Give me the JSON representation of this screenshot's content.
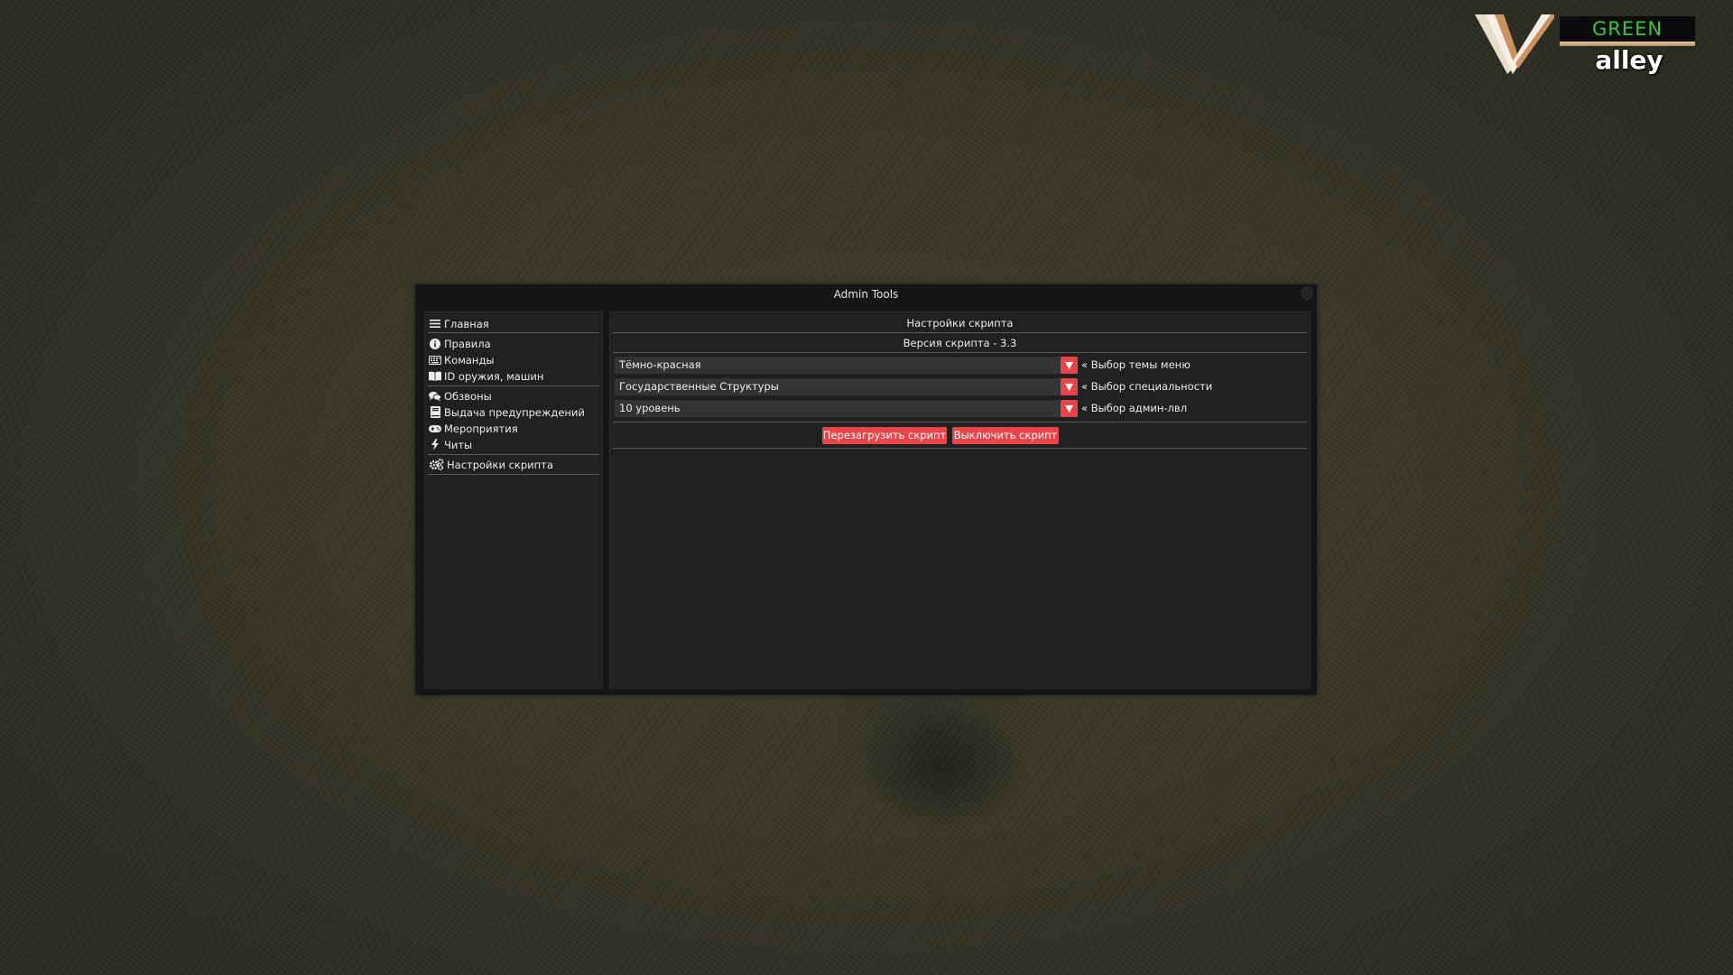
{
  "window": {
    "title": "Admin Tools"
  },
  "logo": {
    "green_text": "GREEN",
    "alley_text": "alley"
  },
  "sidebar": {
    "items": [
      {
        "label": "Главная",
        "icon": "menu-icon"
      },
      {
        "label": "Правила",
        "icon": "info-icon"
      },
      {
        "label": "Команды",
        "icon": "keyboard-icon"
      },
      {
        "label": "ID оружия, машин",
        "icon": "book-icon"
      },
      {
        "label": "Обзвоны",
        "icon": "comments-icon"
      },
      {
        "label": "Выдача предупреждений",
        "icon": "book-closed-icon"
      },
      {
        "label": "Мероприятия",
        "icon": "gamepad-icon"
      },
      {
        "label": "Читы",
        "icon": "bolt-icon"
      },
      {
        "label": "Настройки скрипта",
        "icon": "gears-icon"
      }
    ]
  },
  "content": {
    "header": "Настройки скрипта",
    "version": "Версия скрипта - 3.3",
    "settings": [
      {
        "value": "Тёмно-красная",
        "label": "« Выбор темы меню"
      },
      {
        "value": "Государственные Структуры",
        "label": "« Выбор специальности"
      },
      {
        "value": "10 уровень",
        "label": "« Выбор админ-лвл"
      }
    ],
    "buttons": {
      "reload": "Перезагрузить скрипт",
      "disable": "Выключить скрипт"
    }
  },
  "colors": {
    "accent": "#e8444a",
    "window_bg": "#151515",
    "panel_bg": "#202020",
    "combo_bg": "#333333",
    "text": "#ececec"
  }
}
